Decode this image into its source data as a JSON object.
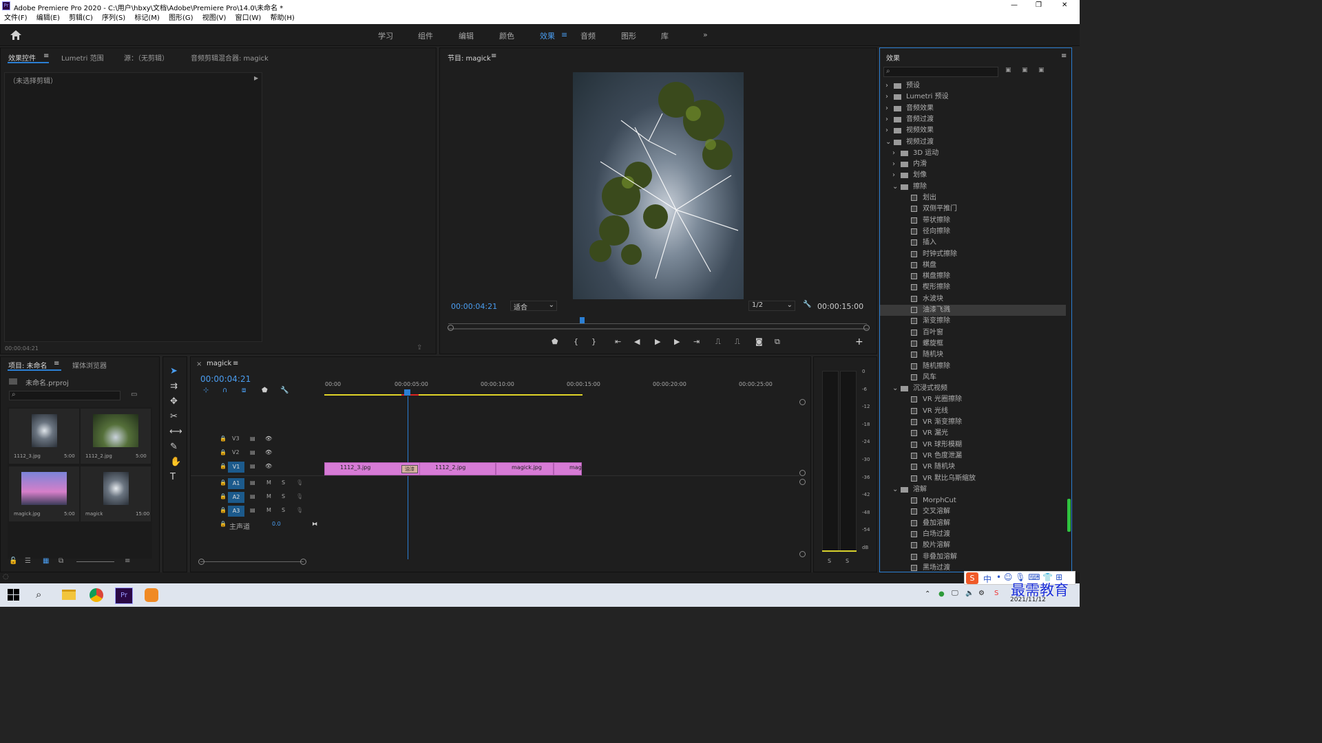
{
  "window": {
    "title": "Adobe Premiere Pro 2020 - C:\\用户\\hbxy\\文档\\Adobe\\Premiere Pro\\14.0\\未命名 *",
    "minimize": "—",
    "maximize": "❐",
    "close": "✕"
  },
  "menu": [
    "文件(F)",
    "编辑(E)",
    "剪辑(C)",
    "序列(S)",
    "标记(M)",
    "图形(G)",
    "视图(V)",
    "窗口(W)",
    "帮助(H)"
  ],
  "workspaces": [
    "学习",
    "组件",
    "编辑",
    "颜色",
    "效果",
    "音频",
    "图形",
    "库"
  ],
  "active_workspace": "效果",
  "source_panel": {
    "tabs": [
      "效果控件",
      "Lumetri 范围",
      "源：（无剪辑）",
      "音频剪辑混合器: magick"
    ],
    "no_clip": "（未选择剪辑）",
    "timecode": "00:00:04:21"
  },
  "program": {
    "tab": "节目: magick",
    "timecode": "00:00:04:21",
    "fit": "适合",
    "resolution": "1/2",
    "duration": "00:00:15:00"
  },
  "effects_panel": {
    "title": "效果",
    "search_placeholder": "",
    "tree": [
      {
        "label": "预设",
        "indent": 0,
        "type": "folder",
        "arrow": "›"
      },
      {
        "label": "Lumetri 预设",
        "indent": 0,
        "type": "folder",
        "arrow": "›"
      },
      {
        "label": "音频效果",
        "indent": 0,
        "type": "folder",
        "arrow": "›"
      },
      {
        "label": "音频过渡",
        "indent": 0,
        "type": "folder",
        "arrow": "›"
      },
      {
        "label": "视频效果",
        "indent": 0,
        "type": "folder",
        "arrow": "›"
      },
      {
        "label": "视频过渡",
        "indent": 0,
        "type": "folder",
        "arrow": "⌄"
      },
      {
        "label": "3D 运动",
        "indent": 1,
        "type": "folder",
        "arrow": "›"
      },
      {
        "label": "内滑",
        "indent": 1,
        "type": "folder",
        "arrow": "›"
      },
      {
        "label": "划像",
        "indent": 1,
        "type": "folder",
        "arrow": "›"
      },
      {
        "label": "擦除",
        "indent": 1,
        "type": "folder",
        "arrow": "⌄"
      },
      {
        "label": "划出",
        "indent": 2,
        "type": "fx"
      },
      {
        "label": "双侧平推门",
        "indent": 2,
        "type": "fx"
      },
      {
        "label": "带状擦除",
        "indent": 2,
        "type": "fx"
      },
      {
        "label": "径向擦除",
        "indent": 2,
        "type": "fx"
      },
      {
        "label": "插入",
        "indent": 2,
        "type": "fx"
      },
      {
        "label": "时钟式擦除",
        "indent": 2,
        "type": "fx"
      },
      {
        "label": "棋盘",
        "indent": 2,
        "type": "fx"
      },
      {
        "label": "棋盘擦除",
        "indent": 2,
        "type": "fx"
      },
      {
        "label": "楔形擦除",
        "indent": 2,
        "type": "fx"
      },
      {
        "label": "水波块",
        "indent": 2,
        "type": "fx"
      },
      {
        "label": "油漆飞溅",
        "indent": 2,
        "type": "fx",
        "selected": true
      },
      {
        "label": "渐变擦除",
        "indent": 2,
        "type": "fx"
      },
      {
        "label": "百叶窗",
        "indent": 2,
        "type": "fx"
      },
      {
        "label": "螺旋框",
        "indent": 2,
        "type": "fx"
      },
      {
        "label": "随机块",
        "indent": 2,
        "type": "fx"
      },
      {
        "label": "随机擦除",
        "indent": 2,
        "type": "fx"
      },
      {
        "label": "风车",
        "indent": 2,
        "type": "fx"
      },
      {
        "label": "沉浸式视频",
        "indent": 1,
        "type": "folder",
        "arrow": "⌄"
      },
      {
        "label": "VR 光圈擦除",
        "indent": 2,
        "type": "fx"
      },
      {
        "label": "VR 光线",
        "indent": 2,
        "type": "fx"
      },
      {
        "label": "VR 渐变擦除",
        "indent": 2,
        "type": "fx"
      },
      {
        "label": "VR 漏光",
        "indent": 2,
        "type": "fx"
      },
      {
        "label": "VR 球形模糊",
        "indent": 2,
        "type": "fx"
      },
      {
        "label": "VR 色度泄漏",
        "indent": 2,
        "type": "fx"
      },
      {
        "label": "VR 随机块",
        "indent": 2,
        "type": "fx"
      },
      {
        "label": "VR 默比乌斯缩放",
        "indent": 2,
        "type": "fx"
      },
      {
        "label": "溶解",
        "indent": 1,
        "type": "folder",
        "arrow": "⌄"
      },
      {
        "label": "MorphCut",
        "indent": 2,
        "type": "fx"
      },
      {
        "label": "交叉溶解",
        "indent": 2,
        "type": "fx"
      },
      {
        "label": "叠加溶解",
        "indent": 2,
        "type": "fx"
      },
      {
        "label": "白场过渡",
        "indent": 2,
        "type": "fx"
      },
      {
        "label": "胶片溶解",
        "indent": 2,
        "type": "fx"
      },
      {
        "label": "非叠加溶解",
        "indent": 2,
        "type": "fx"
      },
      {
        "label": "黑场过渡",
        "indent": 2,
        "type": "fx"
      }
    ]
  },
  "project": {
    "tabs": [
      "项目: 未命名",
      "媒体浏览器"
    ],
    "file": "未命名.prproj",
    "items": [
      {
        "name": "1112_3.jpg",
        "dur": "5:00"
      },
      {
        "name": "1112_2.jpg",
        "dur": "5:00"
      },
      {
        "name": "magick.jpg",
        "dur": "5:00"
      },
      {
        "name": "magick",
        "dur": "15:00"
      }
    ]
  },
  "timeline": {
    "tab": "magick",
    "timecode": "00:00:04:21",
    "ruler": [
      "00:00",
      "00:00:05:00",
      "00:00:10:00",
      "00:00:15:00",
      "00:00:20:00",
      "00:00:25:00"
    ],
    "video_tracks": [
      "V3",
      "V2",
      "V1"
    ],
    "audio_tracks": [
      "A1",
      "A2",
      "A3"
    ],
    "master": "主声道",
    "master_value": "0.0",
    "mute": "M",
    "solo": "S",
    "clips": [
      {
        "name": "1112_3.jpg"
      },
      {
        "name": "1112_2.jpg"
      },
      {
        "name": "magick.jpg"
      },
      {
        "name": "mag"
      }
    ],
    "transition": "油漆"
  },
  "meter": {
    "scale": [
      "0",
      "-6",
      "-12",
      "-18",
      "-24",
      "-30",
      "-36",
      "-42",
      "-48",
      "-54",
      "dB"
    ],
    "solo": [
      "S",
      "S"
    ]
  },
  "taskbar": {
    "date": "2021/11/12"
  },
  "watermark": "最需教育",
  "ime": "中"
}
